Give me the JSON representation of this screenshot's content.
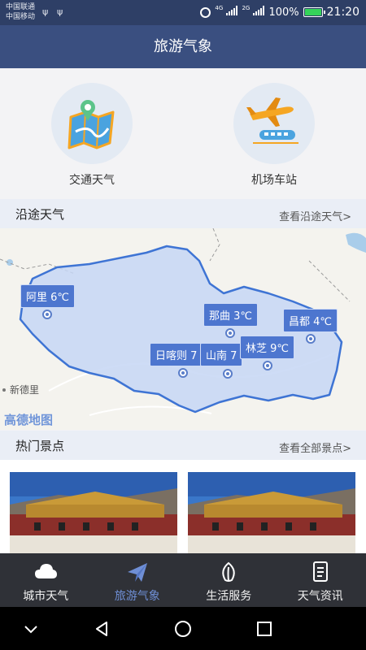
{
  "status_bar": {
    "carrier_1": "中国联通",
    "carrier_2": "中国移动",
    "network_1": "4G",
    "network_2": "2G",
    "battery": "100%",
    "time": "21:20"
  },
  "header": {
    "title": "旅游气象"
  },
  "shortcuts": [
    {
      "label": "交通天气",
      "icon": "map-pin-icon"
    },
    {
      "label": "机场车站",
      "icon": "airplane-train-icon"
    }
  ],
  "route_weather": {
    "title": "沿途天气",
    "more": "查看沿途天气>"
  },
  "map": {
    "cities": [
      {
        "name": "阿里",
        "temp": "6℃"
      },
      {
        "name": "那曲",
        "temp": "3℃"
      },
      {
        "name": "昌都",
        "temp": "4℃"
      },
      {
        "name": "日喀则",
        "temp": "7"
      },
      {
        "name": "山南",
        "temp": "7"
      },
      {
        "name": "林芝",
        "temp": "9℃"
      }
    ],
    "place_label": "新德里",
    "logo": "高德地图",
    "colors": {
      "region_fill": "#c5d6f5",
      "region_border": "#3e74d4",
      "label_bg": "#4d76cf"
    }
  },
  "hot_spots": {
    "title": "热门景点",
    "more": "查看全部景点>"
  },
  "tabs": [
    {
      "label": "城市天气",
      "icon": "cloud-icon",
      "active": false
    },
    {
      "label": "旅游气象",
      "icon": "paper-plane-icon",
      "active": true
    },
    {
      "label": "生活服务",
      "icon": "leaf-icon",
      "active": false
    },
    {
      "label": "天气资讯",
      "icon": "news-icon",
      "active": false
    }
  ],
  "colors": {
    "accent": "#3a4f80",
    "active_tab": "#6f8fd6"
  }
}
